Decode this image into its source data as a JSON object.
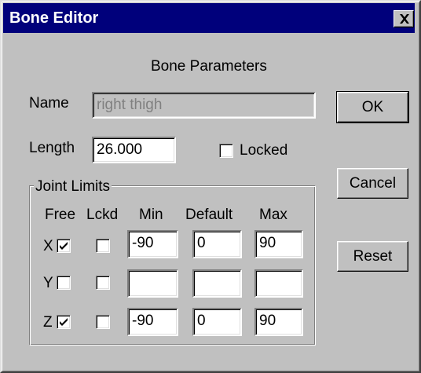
{
  "window": {
    "title": "Bone Editor",
    "close_icon": "close-icon"
  },
  "header": {
    "title": "Bone Parameters"
  },
  "name": {
    "label": "Name",
    "value": "right thigh",
    "disabled": true
  },
  "length": {
    "label": "Length",
    "value": "26.000"
  },
  "locked": {
    "label": "Locked",
    "checked": false
  },
  "buttons": {
    "ok": "OK",
    "cancel": "Cancel",
    "reset": "Reset"
  },
  "joint_limits": {
    "title": "Joint Limits",
    "columns": {
      "free": "Free",
      "lckd": "Lckd",
      "min": "Min",
      "default": "Default",
      "max": "Max"
    },
    "rows": [
      {
        "axis": "X",
        "free": true,
        "lckd": false,
        "min": "-90",
        "default": "0",
        "max": "90"
      },
      {
        "axis": "Y",
        "free": false,
        "lckd": false,
        "min": "",
        "default": "",
        "max": ""
      },
      {
        "axis": "Z",
        "free": true,
        "lckd": false,
        "min": "-90",
        "default": "0",
        "max": "90"
      }
    ]
  },
  "colors": {
    "titlebar": "#00007b",
    "dialog_bg": "#c0c0c0",
    "field_bg": "#ffffff"
  }
}
